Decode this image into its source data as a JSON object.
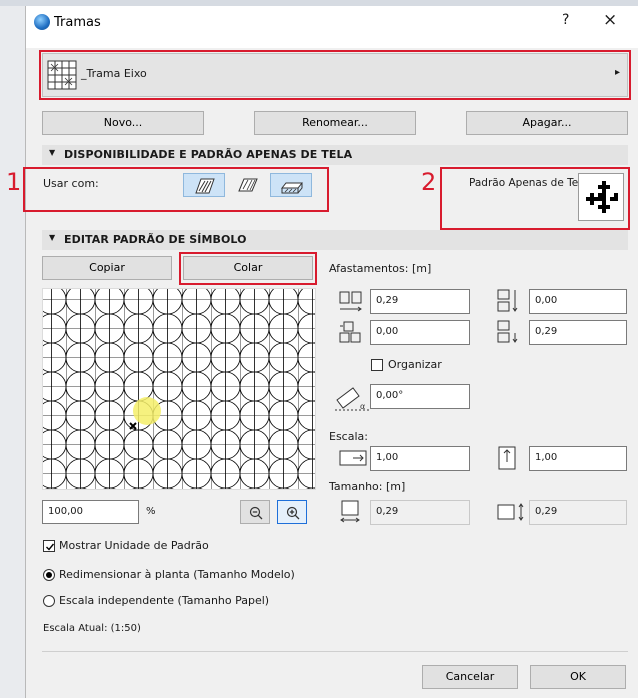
{
  "window": {
    "title": "Tramas",
    "help": "?",
    "close": "×"
  },
  "pattern_selector": {
    "name": "_Trama Eixo",
    "arrow": "▸"
  },
  "actions": {
    "new": "Novo...",
    "rename": "Renomear...",
    "delete": "Apagar..."
  },
  "availability_section": {
    "header": "DISPONIBILIDADE E PADRÃO APENAS DE TELA",
    "use_with_label": "Usar com:",
    "screen_only_label": "Padrão Apenas de Tela:"
  },
  "annotations": {
    "one": "1",
    "two": "2"
  },
  "edit_section": {
    "header": "EDITAR PADRÃO DE SÍMBOLO",
    "copy": "Copiar",
    "paste": "Colar",
    "zoom_value": "100,00",
    "zoom_unit": "%",
    "show_unit": "Mostrar Unidade de Padrão",
    "show_unit_checked": true,
    "resize_option": "Redimensionar à planta (Tamanho Modelo)",
    "independent_option": "Escala independente (Tamanho Papel)",
    "current_scale": "Escala Atual: (1:50)"
  },
  "offsets": {
    "label": "Afastamentos: [m]",
    "x1": "0,29",
    "y1": "0,00",
    "x2": "0,00",
    "y2": "0,29",
    "organize": "Organizar",
    "angle": "0,00°"
  },
  "scale": {
    "label": "Escala:",
    "x": "1,00",
    "y": "1,00"
  },
  "size": {
    "label": "Tamanho: [m]",
    "width": "0,29",
    "height": "0,29"
  },
  "footer": {
    "cancel": "Cancelar",
    "ok": "OK"
  },
  "colors": {
    "annotation_red": "#d81b2e",
    "accent_blue": "#1e6fd9",
    "highlight_yellow": "#f5ef68"
  }
}
